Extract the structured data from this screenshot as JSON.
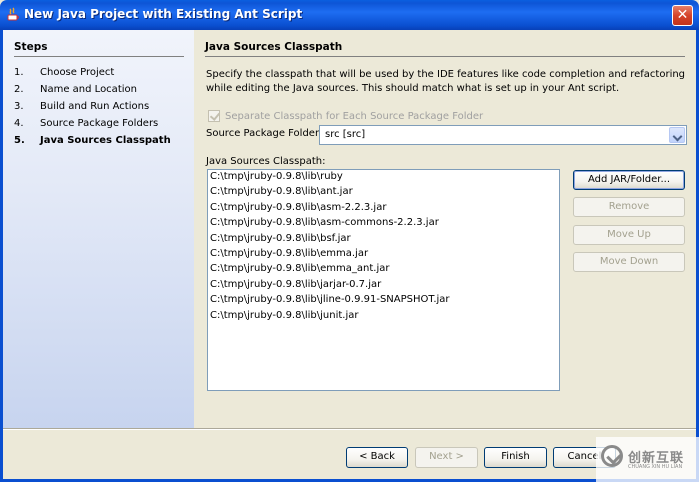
{
  "window": {
    "title": "New Java Project with Existing Ant Script",
    "close_glyph": "✕"
  },
  "steps": {
    "title": "Steps",
    "items": [
      {
        "num": "1.",
        "label": "Choose Project"
      },
      {
        "num": "2.",
        "label": "Name and Location"
      },
      {
        "num": "3.",
        "label": "Build and Run Actions"
      },
      {
        "num": "4.",
        "label": "Source Package Folders"
      },
      {
        "num": "5.",
        "label": "Java Sources Classpath",
        "current": true
      }
    ]
  },
  "main": {
    "title": "Java Sources Classpath",
    "description": "Specify the classpath that will be used by the IDE features like code completion and refactoring while editing the Java sources. This should match what is set up in your Ant script.",
    "separate_checkbox_label": "Separate Classpath for Each Source Package Folder",
    "separate_checkbox_checked": true,
    "separate_checkbox_enabled": false,
    "source_package_folder_label": "Source Package Folder:",
    "source_package_folder_value": "src [src]",
    "classpath_label": "Java Sources Classpath:",
    "classpath_items": [
      "C:\\tmp\\jruby-0.9.8\\lib\\ruby",
      "C:\\tmp\\jruby-0.9.8\\lib\\ant.jar",
      "C:\\tmp\\jruby-0.9.8\\lib\\asm-2.2.3.jar",
      "C:\\tmp\\jruby-0.9.8\\lib\\asm-commons-2.2.3.jar",
      "C:\\tmp\\jruby-0.9.8\\lib\\bsf.jar",
      "C:\\tmp\\jruby-0.9.8\\lib\\emma.jar",
      "C:\\tmp\\jruby-0.9.8\\lib\\emma_ant.jar",
      "C:\\tmp\\jruby-0.9.8\\lib\\jarjar-0.7.jar",
      "C:\\tmp\\jruby-0.9.8\\lib\\jline-0.9.91-SNAPSHOT.jar",
      "C:\\tmp\\jruby-0.9.8\\lib\\junit.jar"
    ],
    "buttons": {
      "add": "Add JAR/Folder...",
      "remove": "Remove",
      "move_up": "Move Up",
      "move_down": "Move Down"
    }
  },
  "nav": {
    "back": "< Back",
    "next": "Next >",
    "finish": "Finish",
    "cancel": "Cancel"
  },
  "watermark": {
    "text": "创新互联",
    "sub": "CHUANG XIN HU LIAN"
  }
}
